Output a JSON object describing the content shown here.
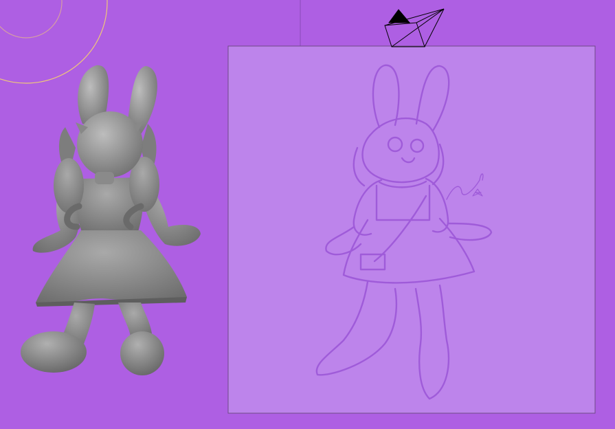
{
  "viewport": {
    "background": "#ae5fe3",
    "mode": "3d-viewport"
  },
  "model": {
    "kind": "bunny character, sculpted mesh",
    "color": "#8c8c8c"
  },
  "reference_image": {
    "kind": "pencil sketch reference plane",
    "signature": "Jade",
    "tint": "#bd84eb"
  },
  "camera": {
    "icon": "camera-icon",
    "stroke": "#000000"
  },
  "light": {
    "icon": "light-gizmo-icon",
    "color": "#f0c878"
  }
}
